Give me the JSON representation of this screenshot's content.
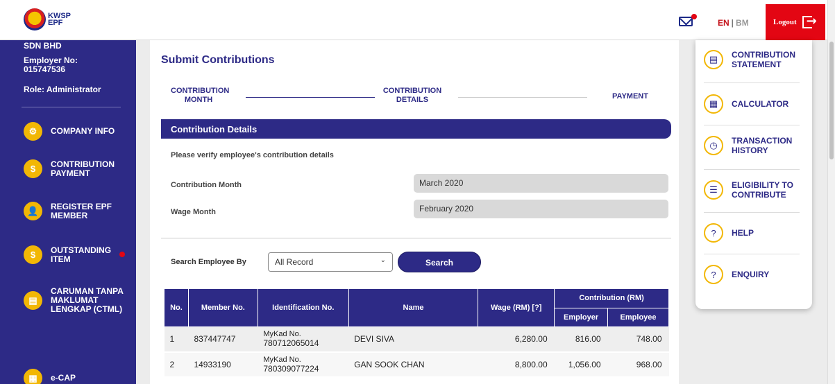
{
  "header": {
    "logo_text_line1": "KWSP",
    "logo_text_line2": "EPF",
    "lang_en": "EN",
    "lang_sep": "|",
    "lang_bm": "BM",
    "logout_label": "Logout"
  },
  "sidebar": {
    "company": "SDN BHD",
    "employer_no": "Employer No: 015747536",
    "role": "Role: Administrator",
    "items": [
      {
        "label": "COMPANY INFO",
        "icon": "gear-icon"
      },
      {
        "label": "CONTRIBUTION PAYMENT",
        "icon": "dollar-hand-icon"
      },
      {
        "label": "REGISTER EPF MEMBER",
        "icon": "user-add-icon"
      },
      {
        "label": "OUTSTANDING ITEM",
        "icon": "money-bag-icon"
      },
      {
        "label": "CARUMAN TANPA MAKLUMAT LENGKAP (CTML)",
        "icon": "document-icon"
      },
      {
        "label": "e-CAP",
        "icon": "building-icon"
      }
    ]
  },
  "main": {
    "title": "Submit Contributions",
    "steps": [
      "CONTRIBUTION MONTH",
      "CONTRIBUTION DETAILS",
      "PAYMENT"
    ],
    "section_title": "Contribution Details",
    "verify_text": "Please verify employee's contribution details",
    "contribution_month_label": "Contribution Month",
    "contribution_month_value": "March 2020",
    "wage_month_label": "Wage Month",
    "wage_month_value": "February 2020",
    "search_label": "Search Employee By",
    "search_select_value": "All Record",
    "search_button": "Search",
    "table": {
      "headers": {
        "no": "No.",
        "member_no": "Member No.",
        "id_no": "Identification No.",
        "name": "Name",
        "wage": "Wage (RM) [?]",
        "contribution": "Contribution (RM)",
        "employer": "Employer",
        "employee": "Employee"
      },
      "rows": [
        {
          "no": "1",
          "member_no": "837447747",
          "id_type": "MyKad No.",
          "id_no": "780712065014",
          "name": "DEVI SIVA",
          "wage": "6,280.00",
          "employer": "816.00",
          "employee": "748.00"
        },
        {
          "no": "2",
          "member_no": "14933190",
          "id_type": "MyKad No.",
          "id_no": "780309077224",
          "name": "GAN SOOK CHAN",
          "wage": "8,800.00",
          "employer": "1,056.00",
          "employee": "968.00"
        }
      ]
    }
  },
  "quick_menu": [
    {
      "label": "CONTRIBUTION STATEMENT",
      "icon": "statement-icon"
    },
    {
      "label": "CALCULATOR",
      "icon": "calculator-icon"
    },
    {
      "label": "TRANSACTION HISTORY",
      "icon": "clock-icon"
    },
    {
      "label": "ELIGIBILITY TO CONTRIBUTE",
      "icon": "checklist-icon"
    },
    {
      "label": "HELP",
      "icon": "help-icon"
    },
    {
      "label": "ENQUIRY",
      "icon": "question-icon"
    }
  ],
  "colors": {
    "primary": "#2d2a86",
    "accent": "#f2b705",
    "logout": "#e30613"
  }
}
